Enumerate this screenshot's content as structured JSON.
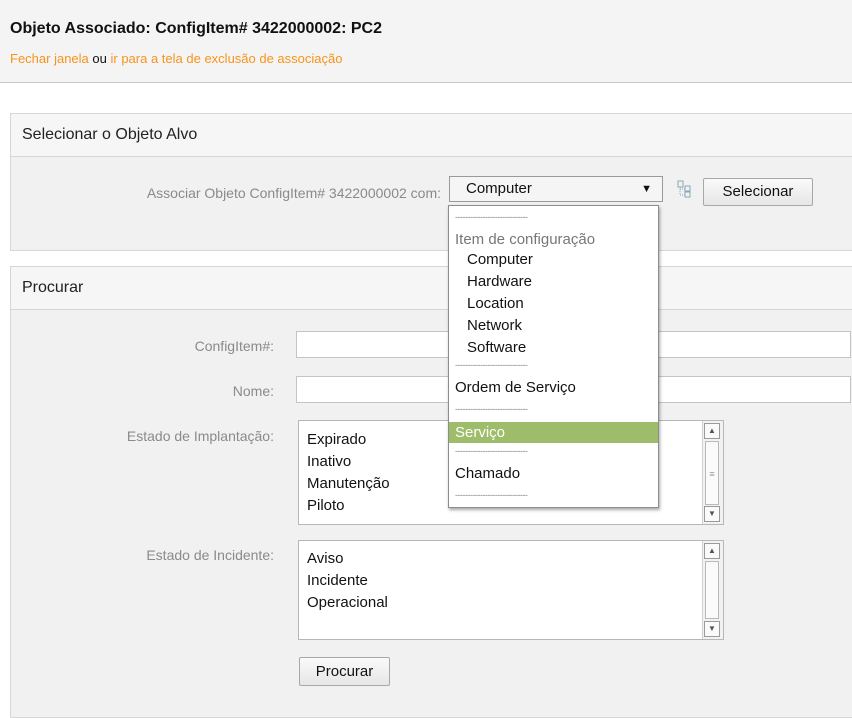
{
  "header": {
    "title": "Objeto Associado: ConfigItem# 3422000002: PC2",
    "close_link": "Fechar janela",
    "conjunction": "ou",
    "delete_link": "ir para a tela de exclusão de associação"
  },
  "target": {
    "section_title": "Selecionar o Objeto Alvo",
    "label": "Associar Objeto ConfigItem# 3422000002 com:",
    "selected": "Computer",
    "select_button": "Selecionar"
  },
  "dropdown": {
    "separator": "-----------------------------",
    "group_label": "Item de configuração",
    "group_items": [
      "Computer",
      "Hardware",
      "Location",
      "Network",
      "Software"
    ],
    "order": "Ordem de Serviço",
    "service": "Serviço",
    "ticket": "Chamado"
  },
  "search": {
    "section_title": "Procurar",
    "configitem_label": "ConfigItem#:",
    "name_label": "Nome:",
    "deploy_label": "Estado de Implantação:",
    "deploy_options": [
      "Expirado",
      "Inativo",
      "Manutenção",
      "Piloto"
    ],
    "incident_label": "Estado de Incidente:",
    "incident_options": [
      "Aviso",
      "Incidente",
      "Operacional"
    ],
    "search_button": "Procurar"
  },
  "colors": {
    "link": "#f7941d",
    "highlight": "#9ebd6a"
  }
}
